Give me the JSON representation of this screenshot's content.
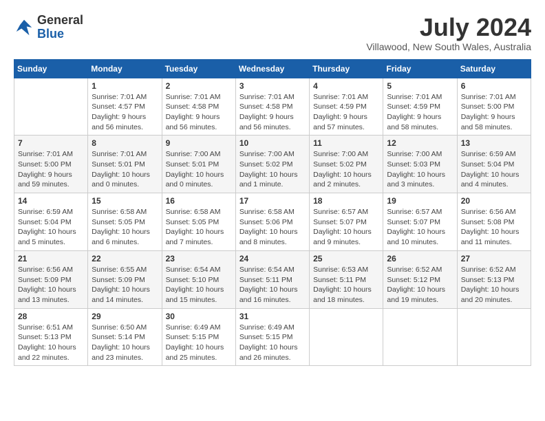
{
  "header": {
    "logo_line1": "General",
    "logo_line2": "Blue",
    "month_year": "July 2024",
    "location": "Villawood, New South Wales, Australia"
  },
  "weekdays": [
    "Sunday",
    "Monday",
    "Tuesday",
    "Wednesday",
    "Thursday",
    "Friday",
    "Saturday"
  ],
  "weeks": [
    [
      {
        "day": "",
        "info": ""
      },
      {
        "day": "1",
        "info": "Sunrise: 7:01 AM\nSunset: 4:57 PM\nDaylight: 9 hours\nand 56 minutes."
      },
      {
        "day": "2",
        "info": "Sunrise: 7:01 AM\nSunset: 4:58 PM\nDaylight: 9 hours\nand 56 minutes."
      },
      {
        "day": "3",
        "info": "Sunrise: 7:01 AM\nSunset: 4:58 PM\nDaylight: 9 hours\nand 56 minutes."
      },
      {
        "day": "4",
        "info": "Sunrise: 7:01 AM\nSunset: 4:59 PM\nDaylight: 9 hours\nand 57 minutes."
      },
      {
        "day": "5",
        "info": "Sunrise: 7:01 AM\nSunset: 4:59 PM\nDaylight: 9 hours\nand 58 minutes."
      },
      {
        "day": "6",
        "info": "Sunrise: 7:01 AM\nSunset: 5:00 PM\nDaylight: 9 hours\nand 58 minutes."
      }
    ],
    [
      {
        "day": "7",
        "info": "Sunrise: 7:01 AM\nSunset: 5:00 PM\nDaylight: 9 hours\nand 59 minutes."
      },
      {
        "day": "8",
        "info": "Sunrise: 7:01 AM\nSunset: 5:01 PM\nDaylight: 10 hours\nand 0 minutes."
      },
      {
        "day": "9",
        "info": "Sunrise: 7:00 AM\nSunset: 5:01 PM\nDaylight: 10 hours\nand 0 minutes."
      },
      {
        "day": "10",
        "info": "Sunrise: 7:00 AM\nSunset: 5:02 PM\nDaylight: 10 hours\nand 1 minute."
      },
      {
        "day": "11",
        "info": "Sunrise: 7:00 AM\nSunset: 5:02 PM\nDaylight: 10 hours\nand 2 minutes."
      },
      {
        "day": "12",
        "info": "Sunrise: 7:00 AM\nSunset: 5:03 PM\nDaylight: 10 hours\nand 3 minutes."
      },
      {
        "day": "13",
        "info": "Sunrise: 6:59 AM\nSunset: 5:04 PM\nDaylight: 10 hours\nand 4 minutes."
      }
    ],
    [
      {
        "day": "14",
        "info": "Sunrise: 6:59 AM\nSunset: 5:04 PM\nDaylight: 10 hours\nand 5 minutes."
      },
      {
        "day": "15",
        "info": "Sunrise: 6:58 AM\nSunset: 5:05 PM\nDaylight: 10 hours\nand 6 minutes."
      },
      {
        "day": "16",
        "info": "Sunrise: 6:58 AM\nSunset: 5:05 PM\nDaylight: 10 hours\nand 7 minutes."
      },
      {
        "day": "17",
        "info": "Sunrise: 6:58 AM\nSunset: 5:06 PM\nDaylight: 10 hours\nand 8 minutes."
      },
      {
        "day": "18",
        "info": "Sunrise: 6:57 AM\nSunset: 5:07 PM\nDaylight: 10 hours\nand 9 minutes."
      },
      {
        "day": "19",
        "info": "Sunrise: 6:57 AM\nSunset: 5:07 PM\nDaylight: 10 hours\nand 10 minutes."
      },
      {
        "day": "20",
        "info": "Sunrise: 6:56 AM\nSunset: 5:08 PM\nDaylight: 10 hours\nand 11 minutes."
      }
    ],
    [
      {
        "day": "21",
        "info": "Sunrise: 6:56 AM\nSunset: 5:09 PM\nDaylight: 10 hours\nand 13 minutes."
      },
      {
        "day": "22",
        "info": "Sunrise: 6:55 AM\nSunset: 5:09 PM\nDaylight: 10 hours\nand 14 minutes."
      },
      {
        "day": "23",
        "info": "Sunrise: 6:54 AM\nSunset: 5:10 PM\nDaylight: 10 hours\nand 15 minutes."
      },
      {
        "day": "24",
        "info": "Sunrise: 6:54 AM\nSunset: 5:11 PM\nDaylight: 10 hours\nand 16 minutes."
      },
      {
        "day": "25",
        "info": "Sunrise: 6:53 AM\nSunset: 5:11 PM\nDaylight: 10 hours\nand 18 minutes."
      },
      {
        "day": "26",
        "info": "Sunrise: 6:52 AM\nSunset: 5:12 PM\nDaylight: 10 hours\nand 19 minutes."
      },
      {
        "day": "27",
        "info": "Sunrise: 6:52 AM\nSunset: 5:13 PM\nDaylight: 10 hours\nand 20 minutes."
      }
    ],
    [
      {
        "day": "28",
        "info": "Sunrise: 6:51 AM\nSunset: 5:13 PM\nDaylight: 10 hours\nand 22 minutes."
      },
      {
        "day": "29",
        "info": "Sunrise: 6:50 AM\nSunset: 5:14 PM\nDaylight: 10 hours\nand 23 minutes."
      },
      {
        "day": "30",
        "info": "Sunrise: 6:49 AM\nSunset: 5:15 PM\nDaylight: 10 hours\nand 25 minutes."
      },
      {
        "day": "31",
        "info": "Sunrise: 6:49 AM\nSunset: 5:15 PM\nDaylight: 10 hours\nand 26 minutes."
      },
      {
        "day": "",
        "info": ""
      },
      {
        "day": "",
        "info": ""
      },
      {
        "day": "",
        "info": ""
      }
    ]
  ]
}
